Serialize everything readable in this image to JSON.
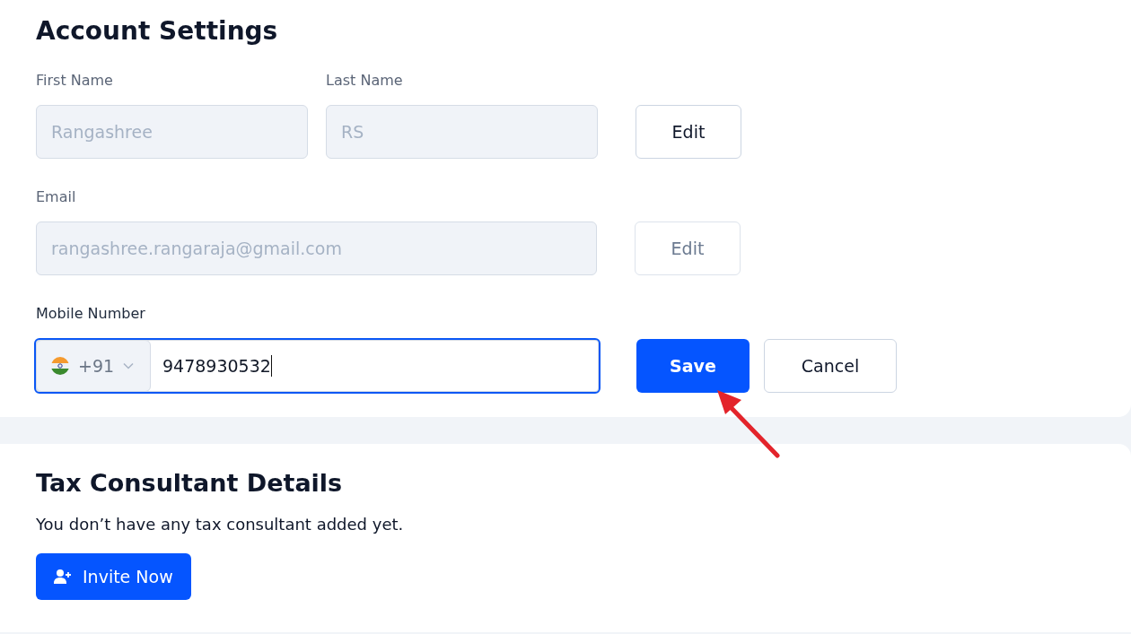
{
  "account_settings": {
    "title": "Account Settings",
    "rows": [
      {
        "fields": [
          {
            "kind": "text",
            "label": "First Name",
            "value": "Rangashree",
            "disabled": true
          },
          {
            "kind": "text",
            "label": "Last Name",
            "value": "RS",
            "disabled": true
          }
        ],
        "buttons": [
          {
            "label": "Edit",
            "kind": "secondary",
            "disabled": false
          }
        ]
      },
      {
        "fields": [
          {
            "kind": "text",
            "label": "Email",
            "value": "rangashree.rangaraja@gmail.com",
            "disabled": true
          }
        ],
        "buttons": [
          {
            "label": "Edit",
            "kind": "secondary",
            "disabled": true
          }
        ]
      },
      {
        "fields": [
          {
            "kind": "phone",
            "label": "Mobile Number",
            "country_code": "+91",
            "value": "9478930532",
            "focused": true
          }
        ],
        "buttons": [
          {
            "label": "Save",
            "kind": "primary",
            "disabled": false
          },
          {
            "label": "Cancel",
            "kind": "secondary",
            "disabled": false
          }
        ]
      }
    ]
  },
  "tax_consultant": {
    "title": "Tax Consultant Details",
    "message": "You don’t have any tax consultant added yet.",
    "button": {
      "label": "Invite Now"
    }
  }
}
